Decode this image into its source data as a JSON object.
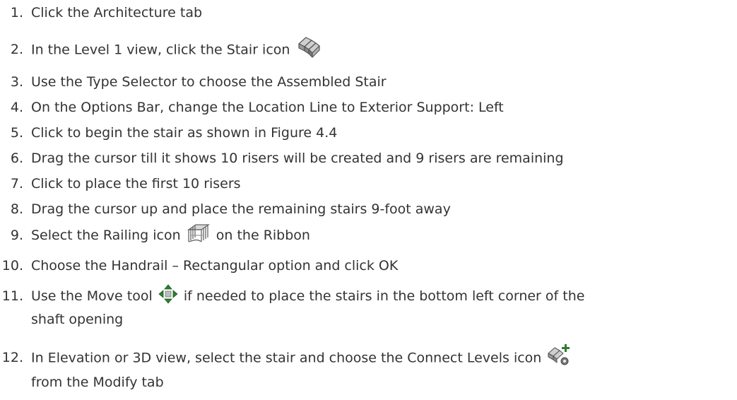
{
  "steps": [
    {
      "num": "1.",
      "text": "Click the Architecture tab"
    },
    {
      "num": "2.",
      "before": "In the Level 1 view, click the Stair icon",
      "icon": "stair-icon"
    },
    {
      "num": "3.",
      "text": "Use the Type Selector to choose the Assembled Stair"
    },
    {
      "num": "4.",
      "text": "On the Options Bar, change the Location Line to Exterior Support: Left"
    },
    {
      "num": "5.",
      "text": "Click to begin the stair as shown in Figure 4.4"
    },
    {
      "num": "6.",
      "text": "Drag the cursor till it shows 10 risers will be created and 9 risers are remaining"
    },
    {
      "num": "7.",
      "text": "Click to place the first 10 risers"
    },
    {
      "num": "8.",
      "text": "Drag the cursor up and place the remaining stairs 9-foot away"
    },
    {
      "num": "9.",
      "before": "Select the Railing icon",
      "icon": "railing-icon",
      "after": "on the Ribbon"
    },
    {
      "num": "10.",
      "text": "Choose the Handrail – Rectangular option and click OK"
    },
    {
      "num": "11.",
      "before": "Use the Move tool",
      "icon": "move-icon",
      "after": "if needed to place the stairs in the bottom left corner of the",
      "line2": "shaft opening"
    },
    {
      "num": "12.",
      "before": "In Elevation or 3D view, select the stair and choose the Connect Levels icon",
      "icon": "connect-levels-icon",
      "line2": "from the Modify tab"
    }
  ]
}
